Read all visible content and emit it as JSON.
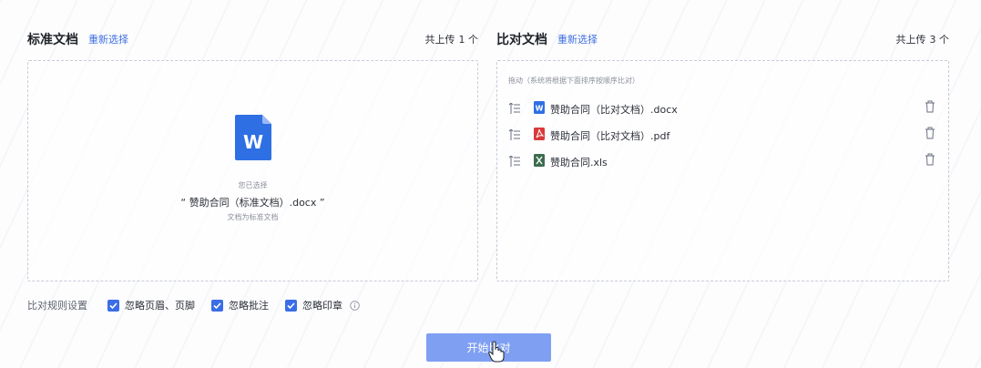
{
  "standard": {
    "title": "标准文档",
    "reselect": "重新选择",
    "count_label": "共上传",
    "count_value": "1 个",
    "chosen_label": "您已选择",
    "chosen_file": "“ 赞助合同（标准文档）.docx ”",
    "chosen_hint": "文档为标准文档",
    "file_icon": "word-doc-icon"
  },
  "compare": {
    "title": "比对文档",
    "reselect": "重新选择",
    "count_label": "共上传",
    "count_value": "3 个",
    "drag_hint": "拖动（系统将根据下面排序按顺序比对）",
    "files": [
      {
        "name": "赞助合同（比对文档）.docx",
        "icon": "word-file-icon"
      },
      {
        "name": "赞助合同（比对文档）.pdf",
        "icon": "pdf-file-icon"
      },
      {
        "name": "赞助合同.xls",
        "icon": "excel-file-icon"
      }
    ]
  },
  "rules": {
    "label": "比对规则设置",
    "options": [
      {
        "label": "忽略页眉、页脚",
        "checked": true
      },
      {
        "label": "忽略批注",
        "checked": true
      },
      {
        "label": "忽略印章",
        "checked": true
      }
    ]
  },
  "actions": {
    "start_label": "开始比对"
  },
  "colors": {
    "accent": "#3b6ee6",
    "button": "#7f9ff2",
    "word": "#2f6fe4",
    "pdf": "#d93a3a",
    "excel": "#3d6b4f"
  }
}
